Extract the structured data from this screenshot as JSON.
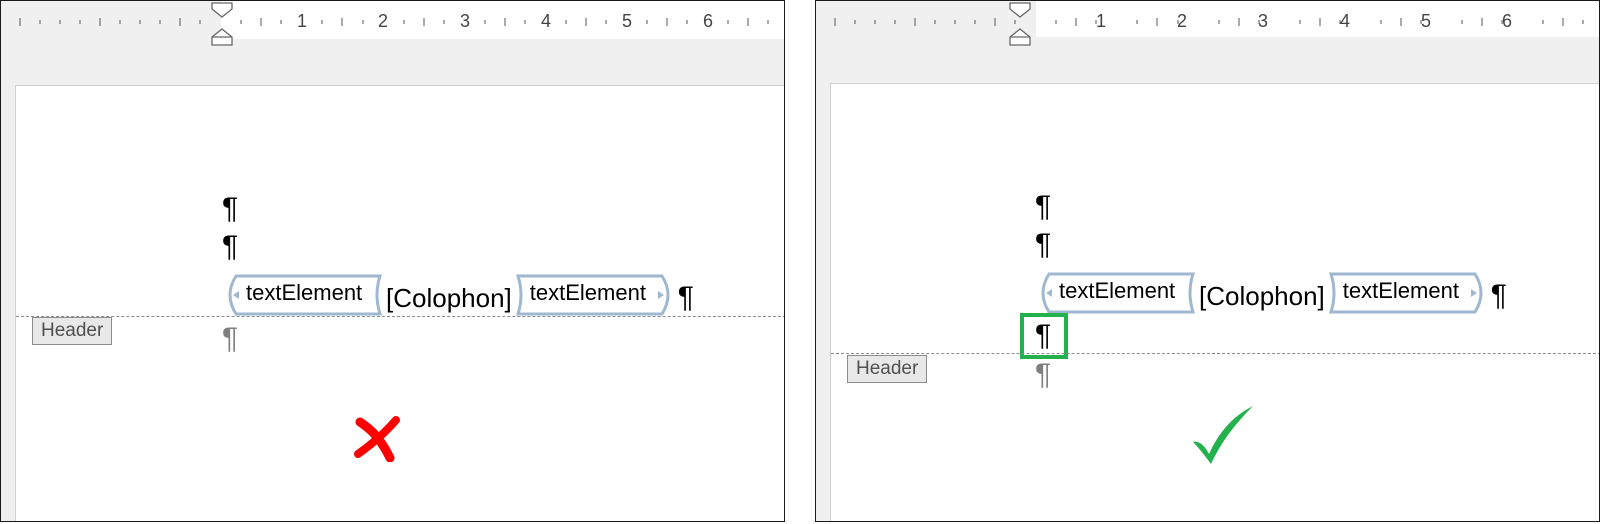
{
  "ruler": {
    "numbers": [
      "1",
      "2",
      "3",
      "4",
      "5",
      "6"
    ]
  },
  "document": {
    "pilcrow": "¶",
    "tag_left_label": "textElement",
    "tag_right_label": "textElement",
    "colophon_text": "[Colophon]",
    "header_label": "Header"
  },
  "marks": {
    "wrong": {
      "icon": "red-cross-icon",
      "color": "#ff0000"
    },
    "correct": {
      "icon": "green-check-icon",
      "color": "#22b14c"
    }
  },
  "colors": {
    "tag_border": "#9fb8cf",
    "highlight": "#22b14c"
  }
}
